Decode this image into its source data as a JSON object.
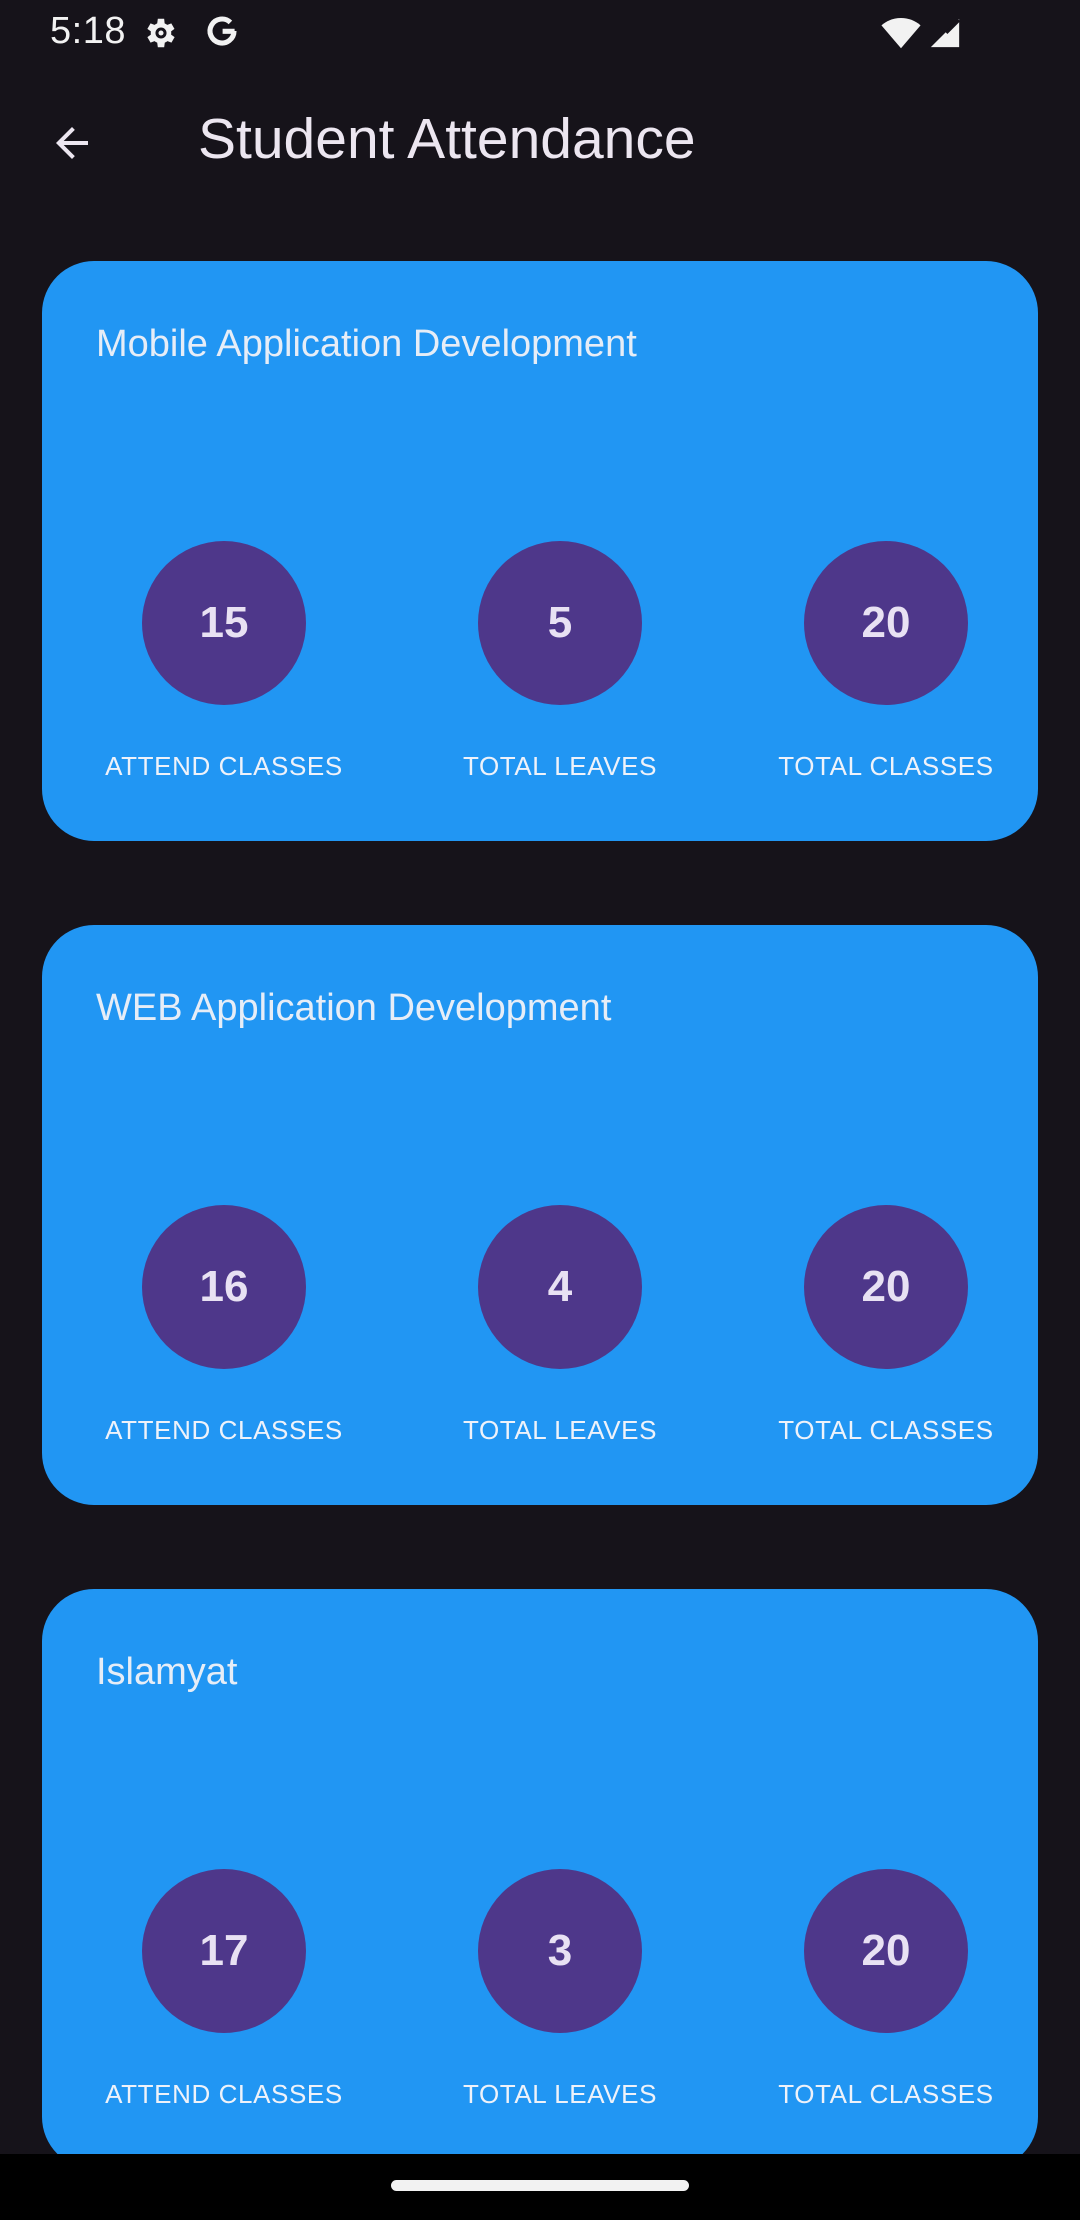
{
  "status_bar": {
    "time": "5:18",
    "icons": [
      "gear-icon",
      "google-g-icon",
      "wifi-icon",
      "signal-icon"
    ]
  },
  "app_bar": {
    "title": "Student Attendance",
    "back_icon": "arrow-back-icon"
  },
  "colors": {
    "background": "#16131a",
    "card": "#2196f3",
    "circle": "#4e378a",
    "text": "#ece6f0"
  },
  "courses": [
    {
      "name": "Mobile Application Development",
      "stats": [
        {
          "value": "15",
          "label": "ATTEND CLASSES"
        },
        {
          "value": "5",
          "label": "TOTAL LEAVES"
        },
        {
          "value": "20",
          "label": "TOTAL CLASSES"
        }
      ]
    },
    {
      "name": "WEB Application Development",
      "stats": [
        {
          "value": "16",
          "label": "ATTEND CLASSES"
        },
        {
          "value": "4",
          "label": "TOTAL LEAVES"
        },
        {
          "value": "20",
          "label": "TOTAL CLASSES"
        }
      ]
    },
    {
      "name": "Islamyat",
      "stats": [
        {
          "value": "17",
          "label": "ATTEND CLASSES"
        },
        {
          "value": "3",
          "label": "TOTAL LEAVES"
        },
        {
          "value": "20",
          "label": "TOTAL CLASSES"
        }
      ]
    }
  ]
}
